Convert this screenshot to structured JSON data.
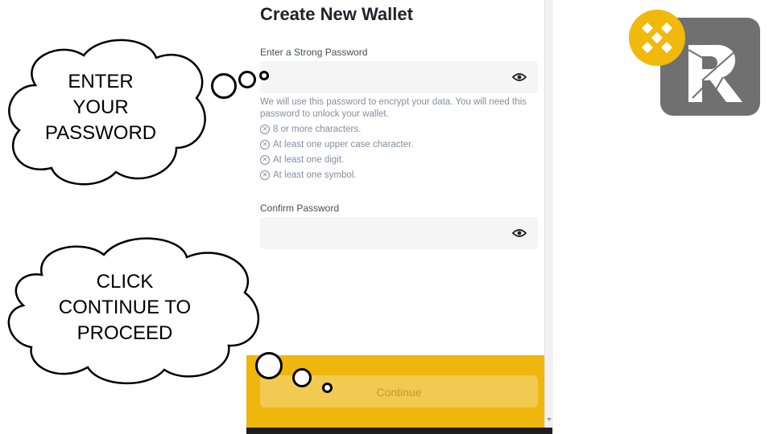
{
  "wallet": {
    "title": "Create New Wallet",
    "password_label": "Enter a Strong Password",
    "password_value": "",
    "hint": "We will use this password to encrypt your data. You will need this password to unlock your wallet.",
    "requirements": [
      "8 or more characters.",
      "At least one upper case character.",
      "At least one digit.",
      "At least one symbol."
    ],
    "confirm_label": "Confirm Password",
    "confirm_value": "",
    "continue_label": "Continue"
  },
  "callouts": {
    "top": [
      "ENTER",
      "YOUR",
      "PASSWORD"
    ],
    "bottom": [
      "CLICK",
      "CONTINUE TO",
      "PROCEED"
    ]
  },
  "logo": {
    "letter": "R",
    "icon": "binance-icon"
  },
  "colors": {
    "accent": "#efb70d",
    "button": "#f2ca52",
    "button_text": "#c79a1d",
    "logo_bg": "#707070"
  }
}
